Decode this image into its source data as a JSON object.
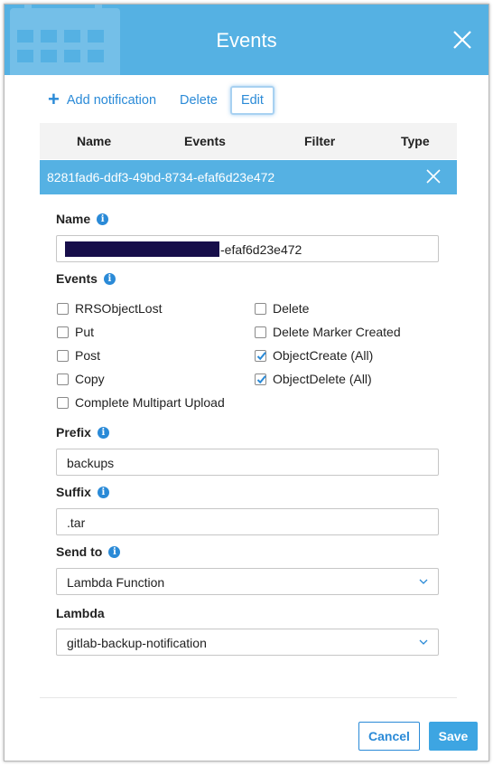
{
  "dialog": {
    "title": "Events"
  },
  "toolbar": {
    "add_label": "Add notification",
    "delete_label": "Delete",
    "edit_label": "Edit"
  },
  "table": {
    "columns": [
      "Name",
      "Events",
      "Filter",
      "Type"
    ],
    "selected_row_id": "8281fad6-ddf3-49bd-8734-efaf6d23e472"
  },
  "form": {
    "name_label": "Name",
    "name_value_visible": "-efaf6d23e472",
    "events_label": "Events",
    "events": [
      {
        "label": "RRSObjectLost",
        "checked": false
      },
      {
        "label": "Put",
        "checked": false
      },
      {
        "label": "Post",
        "checked": false
      },
      {
        "label": "Copy",
        "checked": false
      },
      {
        "label": "Complete Multipart Upload",
        "checked": false
      },
      {
        "label": "Delete",
        "checked": false
      },
      {
        "label": "Delete Marker Created",
        "checked": false
      },
      {
        "label": "ObjectCreate (All)",
        "checked": true
      },
      {
        "label": "ObjectDelete (All)",
        "checked": true
      }
    ],
    "prefix_label": "Prefix",
    "prefix_value": "backups",
    "suffix_label": "Suffix",
    "suffix_value": ".tar",
    "send_to_label": "Send to",
    "send_to_value": "Lambda Function",
    "lambda_label": "Lambda",
    "lambda_value": "gitlab-backup-notification"
  },
  "footer": {
    "cancel_label": "Cancel",
    "save_label": "Save"
  },
  "colors": {
    "accent": "#55b1e3",
    "link": "#2a8ad7",
    "save": "#3da5e2",
    "redaction": "#170e4a"
  },
  "icons": {
    "close": "close-icon",
    "add": "plus-icon",
    "info": "info-icon",
    "dropdown": "chevron-down-icon",
    "check": "checkmark-icon",
    "header_background": "calendar-icon"
  }
}
